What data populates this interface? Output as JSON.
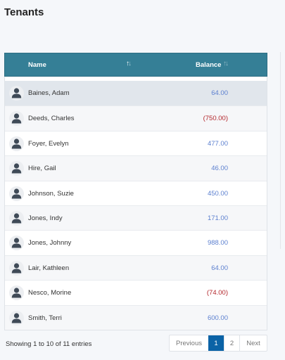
{
  "page": {
    "title": "Tenants"
  },
  "table": {
    "columns": {
      "name": "Name",
      "balance": "Balance"
    },
    "rows": [
      {
        "name": "Baines, Adam",
        "balance": "64.00",
        "negative": false,
        "selected": true
      },
      {
        "name": "Deeds, Charles",
        "balance": "(750.00)",
        "negative": true
      },
      {
        "name": "Foyer, Evelyn",
        "balance": "477.00",
        "negative": false
      },
      {
        "name": "Hire, Gail",
        "balance": "46.00",
        "negative": false
      },
      {
        "name": "Johnson, Suzie",
        "balance": "450.00",
        "negative": false
      },
      {
        "name": "Jones, Indy",
        "balance": "171.00",
        "negative": false
      },
      {
        "name": "Jones, Johnny",
        "balance": "988.00",
        "negative": false
      },
      {
        "name": "Lair, Kathleen",
        "balance": "64.00",
        "negative": false
      },
      {
        "name": "Nesco, Morine",
        "balance": "(74.00)",
        "negative": true
      },
      {
        "name": "Smith, Terri",
        "balance": "600.00",
        "negative": false
      }
    ],
    "avatar_icon": "user-icon",
    "sort_icon": "sort-arrows-icon"
  },
  "footer": {
    "info": "Showing 1 to 10 of 11 entries",
    "pagination": {
      "previous": "Previous",
      "pages": [
        "1",
        "2"
      ],
      "current": "1",
      "next": "Next"
    }
  },
  "colors": {
    "header_bg": "#357f96",
    "positive_balance": "#5b7fcf",
    "negative_balance": "#b3262b",
    "active_page": "#0b63a6"
  }
}
